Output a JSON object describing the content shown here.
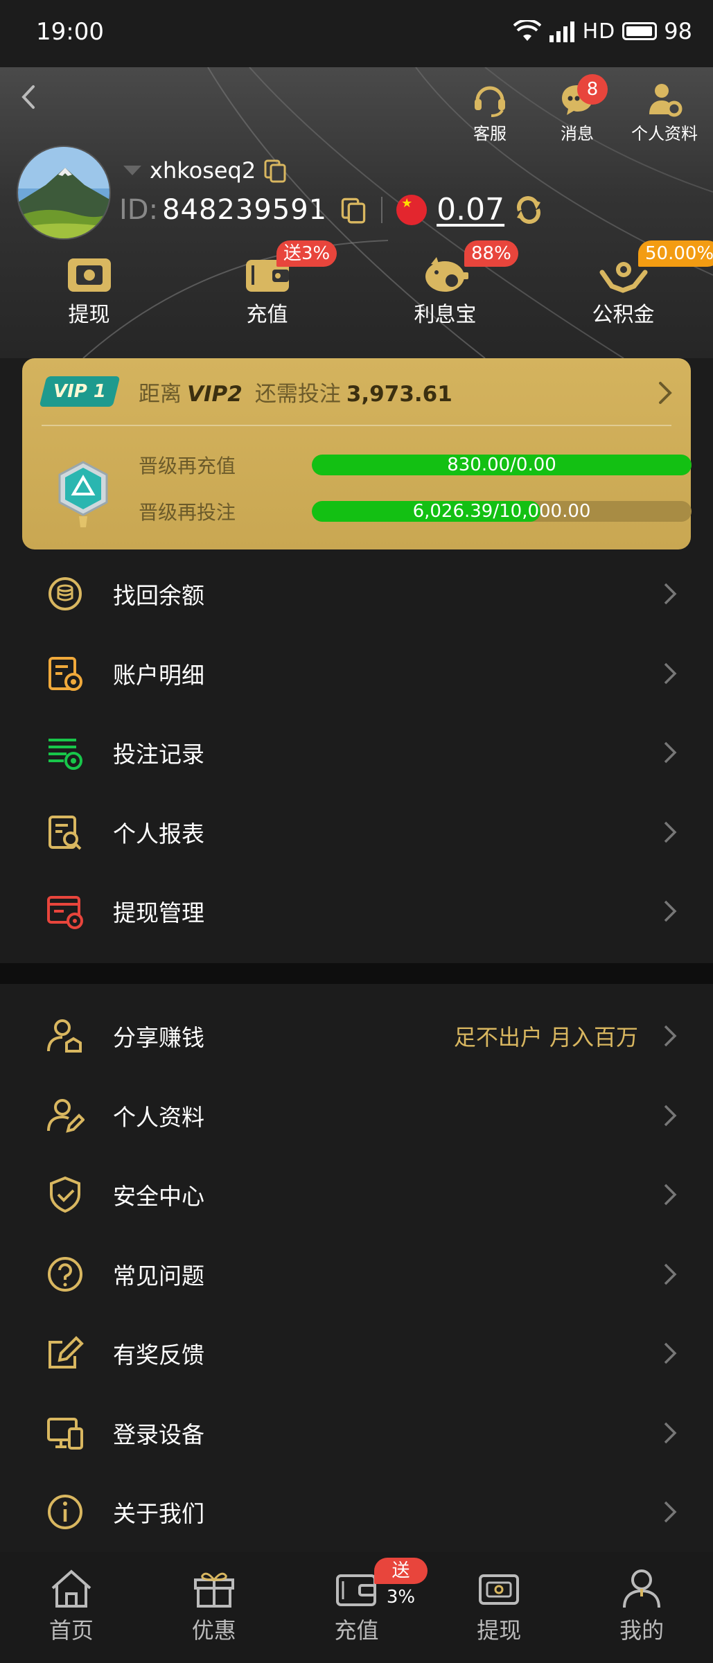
{
  "status_bar": {
    "time": "19:00",
    "network": "HD",
    "battery": "98"
  },
  "header": {
    "actions": [
      {
        "label": "客服",
        "icon": "headset-icon"
      },
      {
        "label": "消息",
        "icon": "message-icon",
        "badge": "8"
      },
      {
        "label": "个人资料",
        "icon": "user-settings-icon"
      }
    ],
    "username": "xhkoseq2",
    "id_label": "ID:",
    "id_value": "848239591",
    "balance": "0.07"
  },
  "quick_actions": [
    {
      "label": "提现",
      "icon": "withdraw-icon",
      "badge": ""
    },
    {
      "label": "充值",
      "icon": "wallet-icon",
      "badge": "送3%"
    },
    {
      "label": "利息宝",
      "icon": "piggy-bank-icon",
      "badge": "88%"
    },
    {
      "label": "公积金",
      "icon": "fund-hands-icon",
      "badge": "50.00%"
    }
  ],
  "vip": {
    "level": "VIP 1",
    "distance_label": "距离",
    "next_level": "VIP2",
    "remaining_label": "还需投注",
    "remaining_value": "3,973.61",
    "progress": [
      {
        "label": "晋级再充值",
        "text": "830.00/0.00",
        "fraction": 1.0
      },
      {
        "label": "晋级再投注",
        "text": "6,026.39/10,000.00",
        "fraction": 0.6026
      }
    ]
  },
  "menu_group_1": [
    {
      "label": "找回余额",
      "icon": "coins-icon"
    },
    {
      "label": "账户明细",
      "icon": "account-detail-icon"
    },
    {
      "label": "投注记录",
      "icon": "bet-record-icon"
    },
    {
      "label": "个人报表",
      "icon": "report-icon"
    },
    {
      "label": "提现管理",
      "icon": "withdraw-manage-icon"
    }
  ],
  "menu_group_2": [
    {
      "label": "分享赚钱",
      "icon": "share-earn-icon",
      "extra": "足不出户 月入百万"
    },
    {
      "label": "个人资料",
      "icon": "profile-edit-icon",
      "extra": ""
    },
    {
      "label": "安全中心",
      "icon": "shield-icon",
      "extra": ""
    },
    {
      "label": "常见问题",
      "icon": "question-icon",
      "extra": ""
    },
    {
      "label": "有奖反馈",
      "icon": "feedback-edit-icon",
      "extra": ""
    },
    {
      "label": "登录设备",
      "icon": "devices-icon",
      "extra": ""
    },
    {
      "label": "关于我们",
      "icon": "info-icon",
      "extra": ""
    }
  ],
  "bottom_nav": [
    {
      "label": "首页",
      "icon": "home-icon",
      "badge": ""
    },
    {
      "label": "优惠",
      "icon": "gift-icon",
      "badge": ""
    },
    {
      "label": "充值",
      "icon": "wallet-icon",
      "badge": "送3%"
    },
    {
      "label": "提现",
      "icon": "withdraw-icon",
      "badge": ""
    },
    {
      "label": "我的",
      "icon": "user-icon",
      "badge": ""
    }
  ],
  "colors": {
    "accent_gold": "#d9b760",
    "badge_red": "#e8453c",
    "progress_green": "#13c013"
  }
}
